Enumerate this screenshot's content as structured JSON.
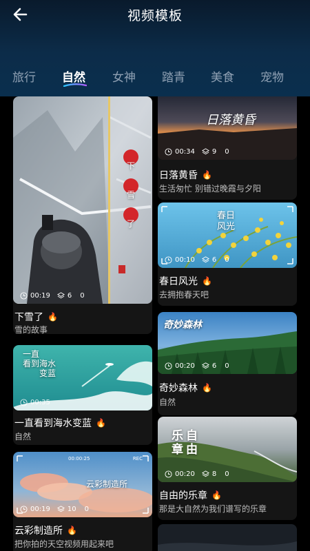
{
  "header": {
    "title": "视频模板"
  },
  "tabs": [
    "旅行",
    "自然",
    "女神",
    "踏青",
    "美食",
    "宠物"
  ],
  "active_tab": "自然",
  "colors": {
    "accent_fire": "#ff8c1a",
    "underline_start": "#29c7ff",
    "underline_end": "#b25cff"
  },
  "cards": {
    "snow": {
      "title": "下雪了",
      "desc": "雪的故事",
      "duration": "00:19",
      "clips": "6",
      "count": "0",
      "overlay": "下雪了"
    },
    "sea": {
      "title": "一直看到海水变蓝",
      "desc": "自然",
      "duration": "00:35",
      "clips": "",
      "count": "",
      "overlay_line1": "一直",
      "overlay_line2": "看到海水",
      "overlay_line3": "变蓝"
    },
    "cloud": {
      "title": "云彩制造所",
      "desc": "把你拍的天空视频用起来吧",
      "duration": "00:19",
      "clips": "10",
      "count": "0",
      "overlay": "云彩制造所",
      "rec": "REC",
      "timecode": "00:00:25"
    },
    "sunset": {
      "title": "日落黄昏",
      "desc": "生活匆忙 别错过晚霞与夕阳",
      "duration": "00:34",
      "clips": "9",
      "count": "0",
      "overlay": "日落黄昏"
    },
    "spring": {
      "title": "春日风光",
      "desc": "去拥抱春天吧",
      "duration": "00:10",
      "clips": "6",
      "count": "0",
      "overlay": "春日风光"
    },
    "forest": {
      "title": "奇妙森林",
      "desc": "自然",
      "duration": "00:20",
      "clips": "6",
      "count": "0",
      "overlay": "奇妙森林"
    },
    "free": {
      "title": "自由的乐章",
      "desc": "那是大自然为我们谱写的乐章",
      "duration": "00:20",
      "clips": "8",
      "count": "0",
      "overlay_a": "乐",
      "overlay_b": "自",
      "overlay_c": "章",
      "overlay_d": "由"
    }
  }
}
